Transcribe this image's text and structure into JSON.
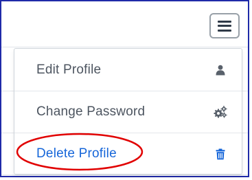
{
  "header": {
    "menu_toggle_icon": "hamburger-menu-icon"
  },
  "menu": {
    "items": [
      {
        "label": "Edit Profile",
        "icon": "user-icon"
      },
      {
        "label": "Change Password",
        "icon": "cogs-icon"
      },
      {
        "label": "Delete Profile",
        "icon": "trash-icon"
      }
    ]
  },
  "colors": {
    "frame_border": "#1f2aa8",
    "menu_text": "#4d5560",
    "delete_text": "#1666d9",
    "delete_icon": "#1666d9",
    "highlight_oval": "#e10000",
    "menu_button_border": "#98a0a8"
  }
}
